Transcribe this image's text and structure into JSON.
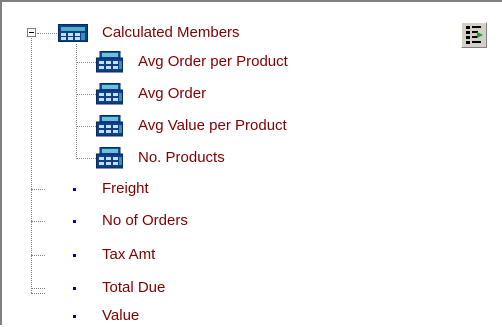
{
  "tree": {
    "root": {
      "label": "Calculated Members",
      "icon": "calculated-members-folder-icon",
      "expanded": true
    },
    "calculated_members": [
      {
        "label": "Avg Order per Product",
        "icon": "calculated-member-icon"
      },
      {
        "label": "Avg Order",
        "icon": "calculated-member-icon"
      },
      {
        "label": "Avg Value per Product",
        "icon": "calculated-member-icon"
      },
      {
        "label": "No. Products",
        "icon": "calculated-member-icon"
      }
    ],
    "measures": [
      {
        "label": "Freight",
        "icon": "measure-bullet-icon"
      },
      {
        "label": "No of Orders",
        "icon": "measure-bullet-icon"
      },
      {
        "label": "Tax Amt",
        "icon": "measure-bullet-icon"
      },
      {
        "label": "Total Due",
        "icon": "measure-bullet-icon"
      },
      {
        "label": "Value",
        "icon": "measure-bullet-icon"
      }
    ]
  },
  "toolbar": {
    "button_icon": "tree-options-icon"
  },
  "colors": {
    "label": "#800000",
    "bullet": "#0000c0",
    "tree_line": "#808080",
    "button_face": "#d4d0c8"
  }
}
